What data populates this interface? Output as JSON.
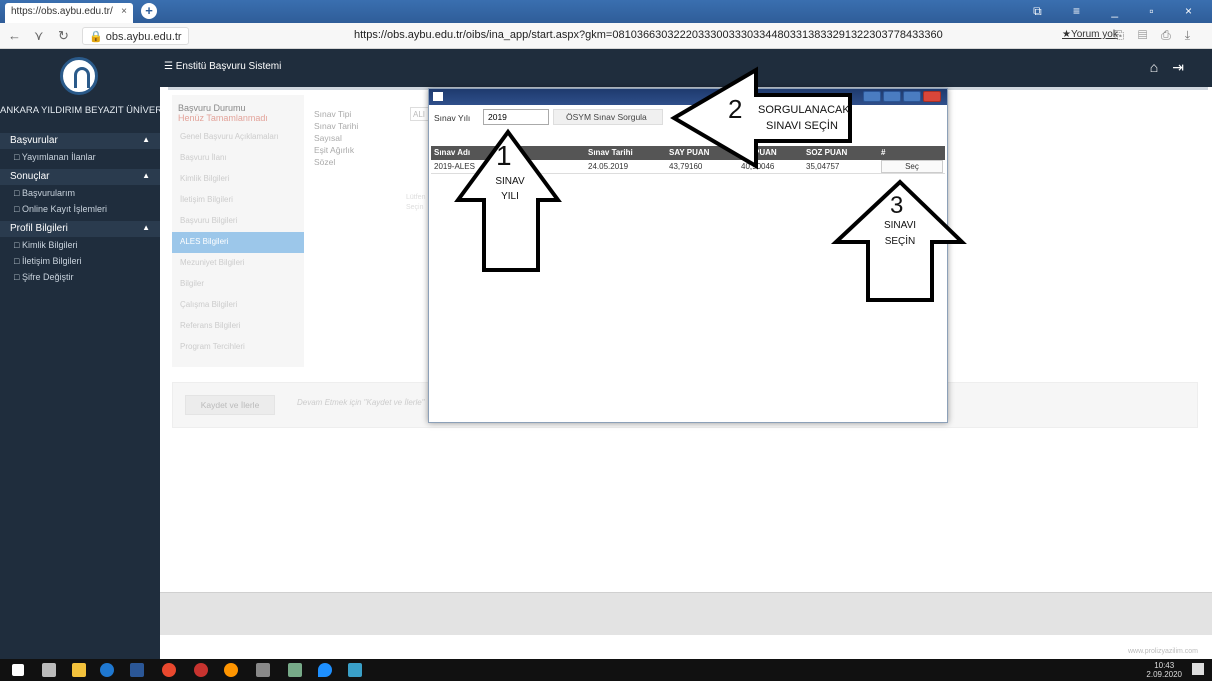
{
  "browser": {
    "tab_title": "https://obs.aybu.edu.tr/",
    "tab_close": "×",
    "new_tab": "+",
    "window_controls": "⧉ ≡ _ ▫ ×",
    "domain": "obs.aybu.edu.tr",
    "url": "https://obs.aybu.edu.tr/oibs/ina_app/start.aspx?gkm=081036630322203330033303344803313833291322303778433360",
    "review": "★Yorum yok"
  },
  "header": {
    "title": "☰ Enstitü Başvuru Sistemi"
  },
  "sidebar": {
    "university": "ANKARA YILDIRIM BEYAZIT ÜNİVERSİTESİ",
    "sections": [
      {
        "title": "Başvurular",
        "items": [
          "Yayımlanan İlanlar"
        ]
      },
      {
        "title": "Sonuçlar",
        "items": [
          "Başvurularım",
          "Online Kayıt İşlemleri"
        ]
      },
      {
        "title": "Profil Bilgileri",
        "items": [
          "Kimlik Bilgileri",
          "İletişim Bilgileri",
          "Şifre Değiştir"
        ]
      }
    ]
  },
  "main": {
    "status_label": "Başvuru Durumu",
    "status_value": "Henüz Tamamlanmadı",
    "steps": [
      "Genel Başvuru Açıklamaları",
      "Başvuru İlanı",
      "Kimlik Bilgileri",
      "İletişim Bilgileri",
      "Başvuru Bilgileri",
      "ALES Bilgileri",
      "Mezuniyet Bilgileri",
      "Bilgiler",
      "Çalışma Bilgileri",
      "Referans Bilgileri",
      "Program Tercihleri"
    ],
    "fields": [
      "Sınav Tipi",
      "Sınav Tarihi",
      "Sayısal",
      "Eşit Ağırlık",
      "Sözel"
    ],
    "exam_type_value": "ALI",
    "save_button": "Kaydet ve İlerle",
    "save_hint": "Devam Etmek için \"Kaydet ve İlerle\"",
    "credit": "www.prolizyazilim.com"
  },
  "modal": {
    "year_label": "Sınav Yılı",
    "year_value": "2019",
    "query_button": "ÖSYM Sınav Sorgula",
    "columns": [
      "Sınav Adı",
      "Sınav Tarihi",
      "SAY PUAN",
      "EA PUAN",
      "SOZ PUAN",
      "#"
    ],
    "rows": [
      {
        "name": "2019-ALES",
        "date": "24.05.2019",
        "say": "43,79160",
        "ea": "40,90046",
        "soz": "35,04757",
        "action": "Seç"
      }
    ]
  },
  "annotations": {
    "a1_num": "1",
    "a1_l1": "SINAV",
    "a1_l2": "YILI",
    "a2_num": "2",
    "a2_l1": "SORGULANACAK",
    "a2_l2": "SINAVI SEÇİN",
    "a3_num": "3",
    "a3_l1": "SINAVI",
    "a3_l2": "SEÇİN"
  },
  "taskbar": {
    "time": "10:43",
    "date": "2.09.2020"
  }
}
